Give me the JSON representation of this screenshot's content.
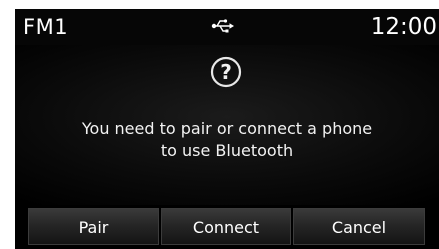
{
  "status_bar": {
    "source": "FM1",
    "usb_icon": "usb-icon",
    "clock": "12:00"
  },
  "dialog": {
    "icon": "question-icon",
    "icon_glyph": "?",
    "message_line1": "You need to pair or connect a phone",
    "message_line2": "to use Bluetooth"
  },
  "buttons": [
    {
      "label": "Pair"
    },
    {
      "label": "Connect"
    },
    {
      "label": "Cancel"
    }
  ],
  "colors": {
    "background": "#000000",
    "text": "#ffffff",
    "button_top": "#3a3a3a",
    "button_bottom": "#141414"
  }
}
